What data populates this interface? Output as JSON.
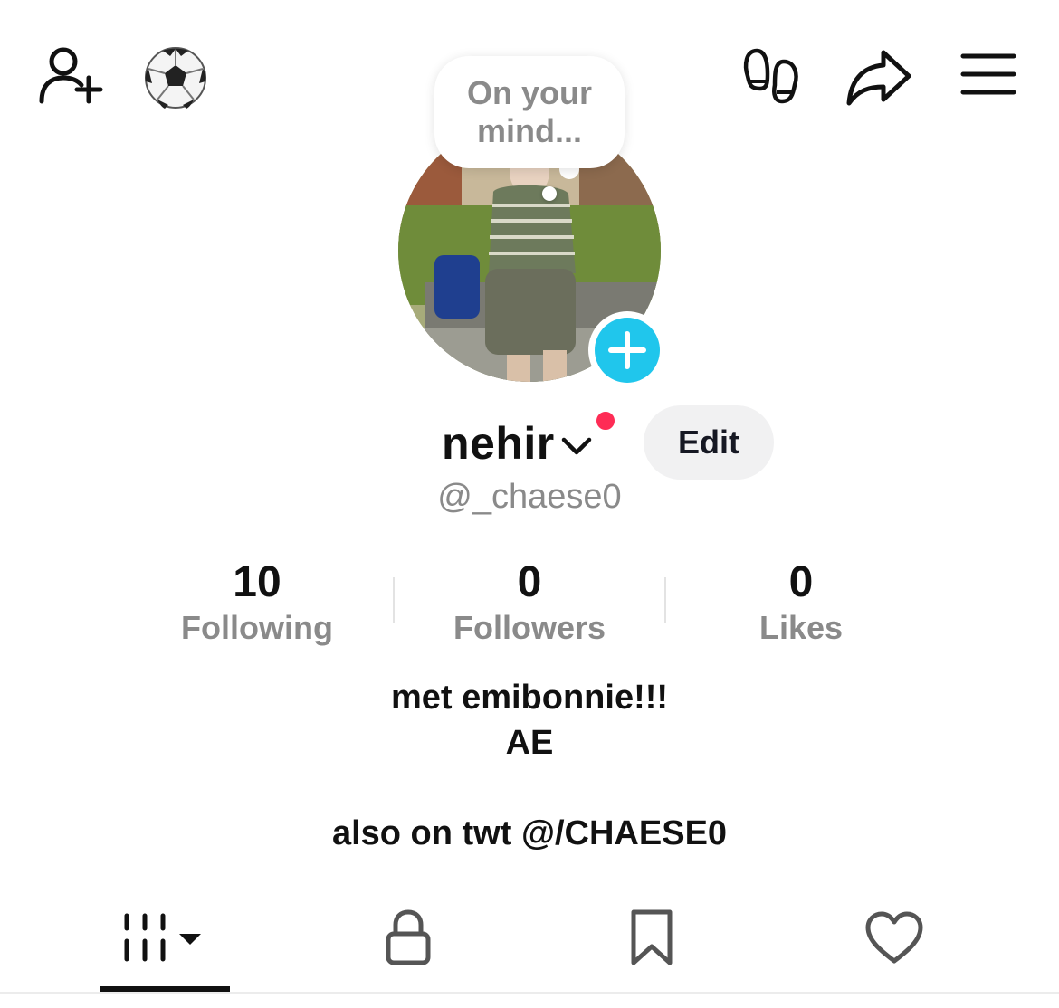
{
  "top_bar": {
    "icons": [
      "add-friend-icon",
      "soccer-ball-icon",
      "footprints-icon",
      "share-icon",
      "menu-icon"
    ]
  },
  "profile": {
    "thought_bubble": "On your mind...",
    "display_name": "nehir",
    "edit_label": "Edit",
    "handle": "@_chaese0",
    "has_notification": true
  },
  "stats": [
    {
      "value": "10",
      "label": "Following"
    },
    {
      "value": "0",
      "label": "Followers"
    },
    {
      "value": "0",
      "label": "Likes"
    }
  ],
  "bio": {
    "line1": "met emibonnie!!!",
    "line2": "AE",
    "line3": "also on twt @/CHAESE0"
  },
  "tabs": [
    {
      "icon": "videos-grid-icon",
      "active": true
    },
    {
      "icon": "lock-icon",
      "active": false
    },
    {
      "icon": "bookmark-icon",
      "active": false
    },
    {
      "icon": "heart-icon",
      "active": false
    }
  ],
  "colors": {
    "accent_red": "#fe2c55",
    "add_story_blue": "#20c6ec",
    "secondary_text": "#8a8a8a"
  }
}
